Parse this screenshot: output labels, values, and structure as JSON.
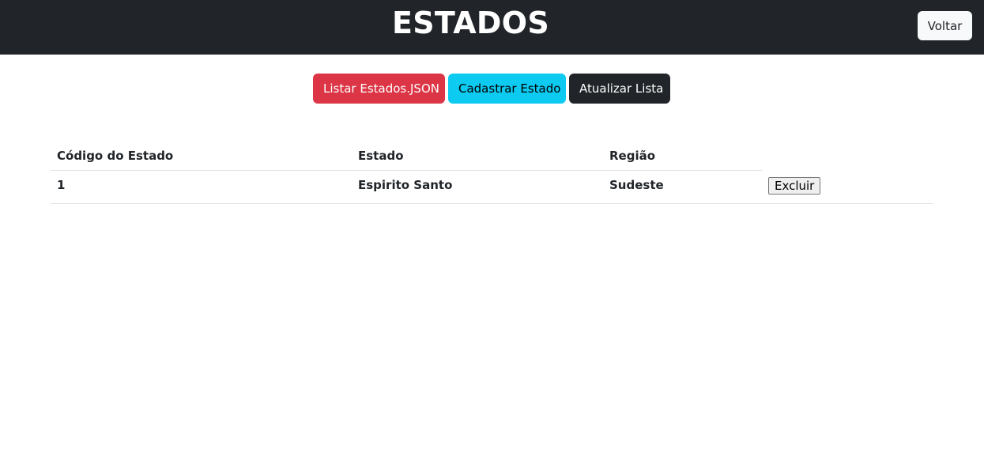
{
  "header": {
    "title": "ESTADOS",
    "back_label": "Voltar"
  },
  "actions": {
    "list_json_label": "Listar Estados.JSON",
    "register_label": "Cadastrar Estado",
    "refresh_label": "Atualizar Lista"
  },
  "table": {
    "columns": [
      "Código do Estado",
      "Estado",
      "Região"
    ],
    "rows": [
      {
        "code": "1",
        "state": "Espirito Santo",
        "region": "Sudeste",
        "delete_label": "Excluir"
      }
    ]
  },
  "colors": {
    "header_bg": "#212529",
    "danger": "#dc3545",
    "info": "#0dcaf0",
    "dark": "#212529"
  }
}
